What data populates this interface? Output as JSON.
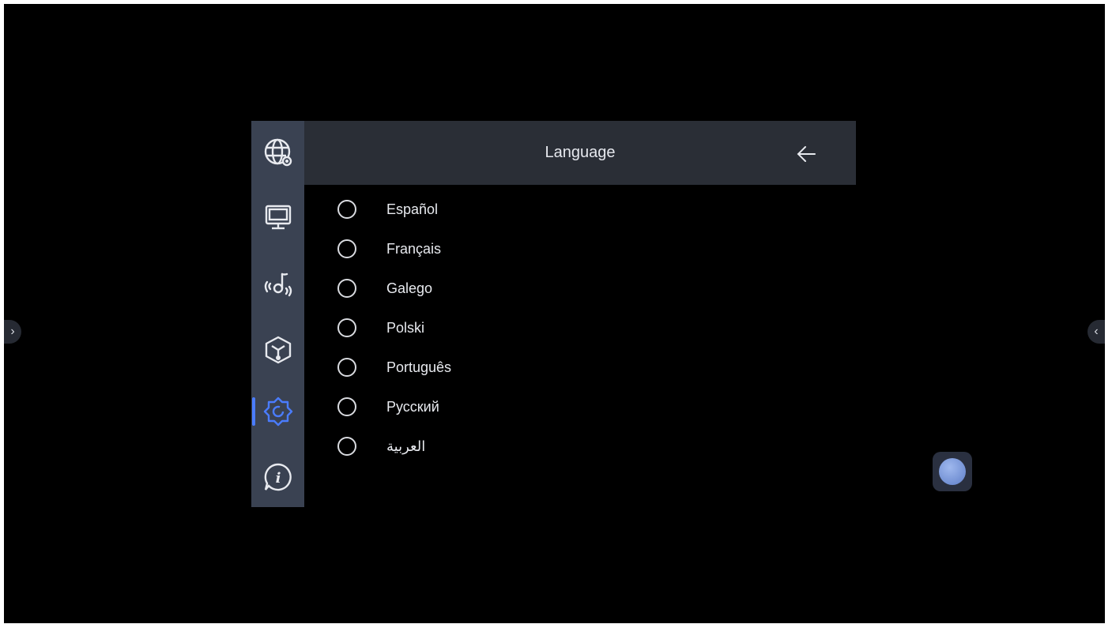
{
  "header": {
    "title": "Language"
  },
  "sidebar": {
    "items": [
      {
        "icon": "network-settings-icon"
      },
      {
        "icon": "display-icon"
      },
      {
        "icon": "audio-icon"
      },
      {
        "icon": "cube-icon"
      },
      {
        "icon": "gear-icon",
        "active": true
      },
      {
        "icon": "info-icon"
      }
    ]
  },
  "languages": [
    {
      "label": "Español",
      "selected": false
    },
    {
      "label": "Français",
      "selected": false
    },
    {
      "label": "Galego",
      "selected": false
    },
    {
      "label": "Polski",
      "selected": false
    },
    {
      "label": "Português",
      "selected": false
    },
    {
      "label": "Русский",
      "selected": false
    },
    {
      "label": "العربية",
      "selected": false
    }
  ],
  "colors": {
    "accent": "#4a7cff",
    "sidebar_bg": "#3a4252",
    "header_bg": "#2a2e36",
    "background": "#000000"
  }
}
